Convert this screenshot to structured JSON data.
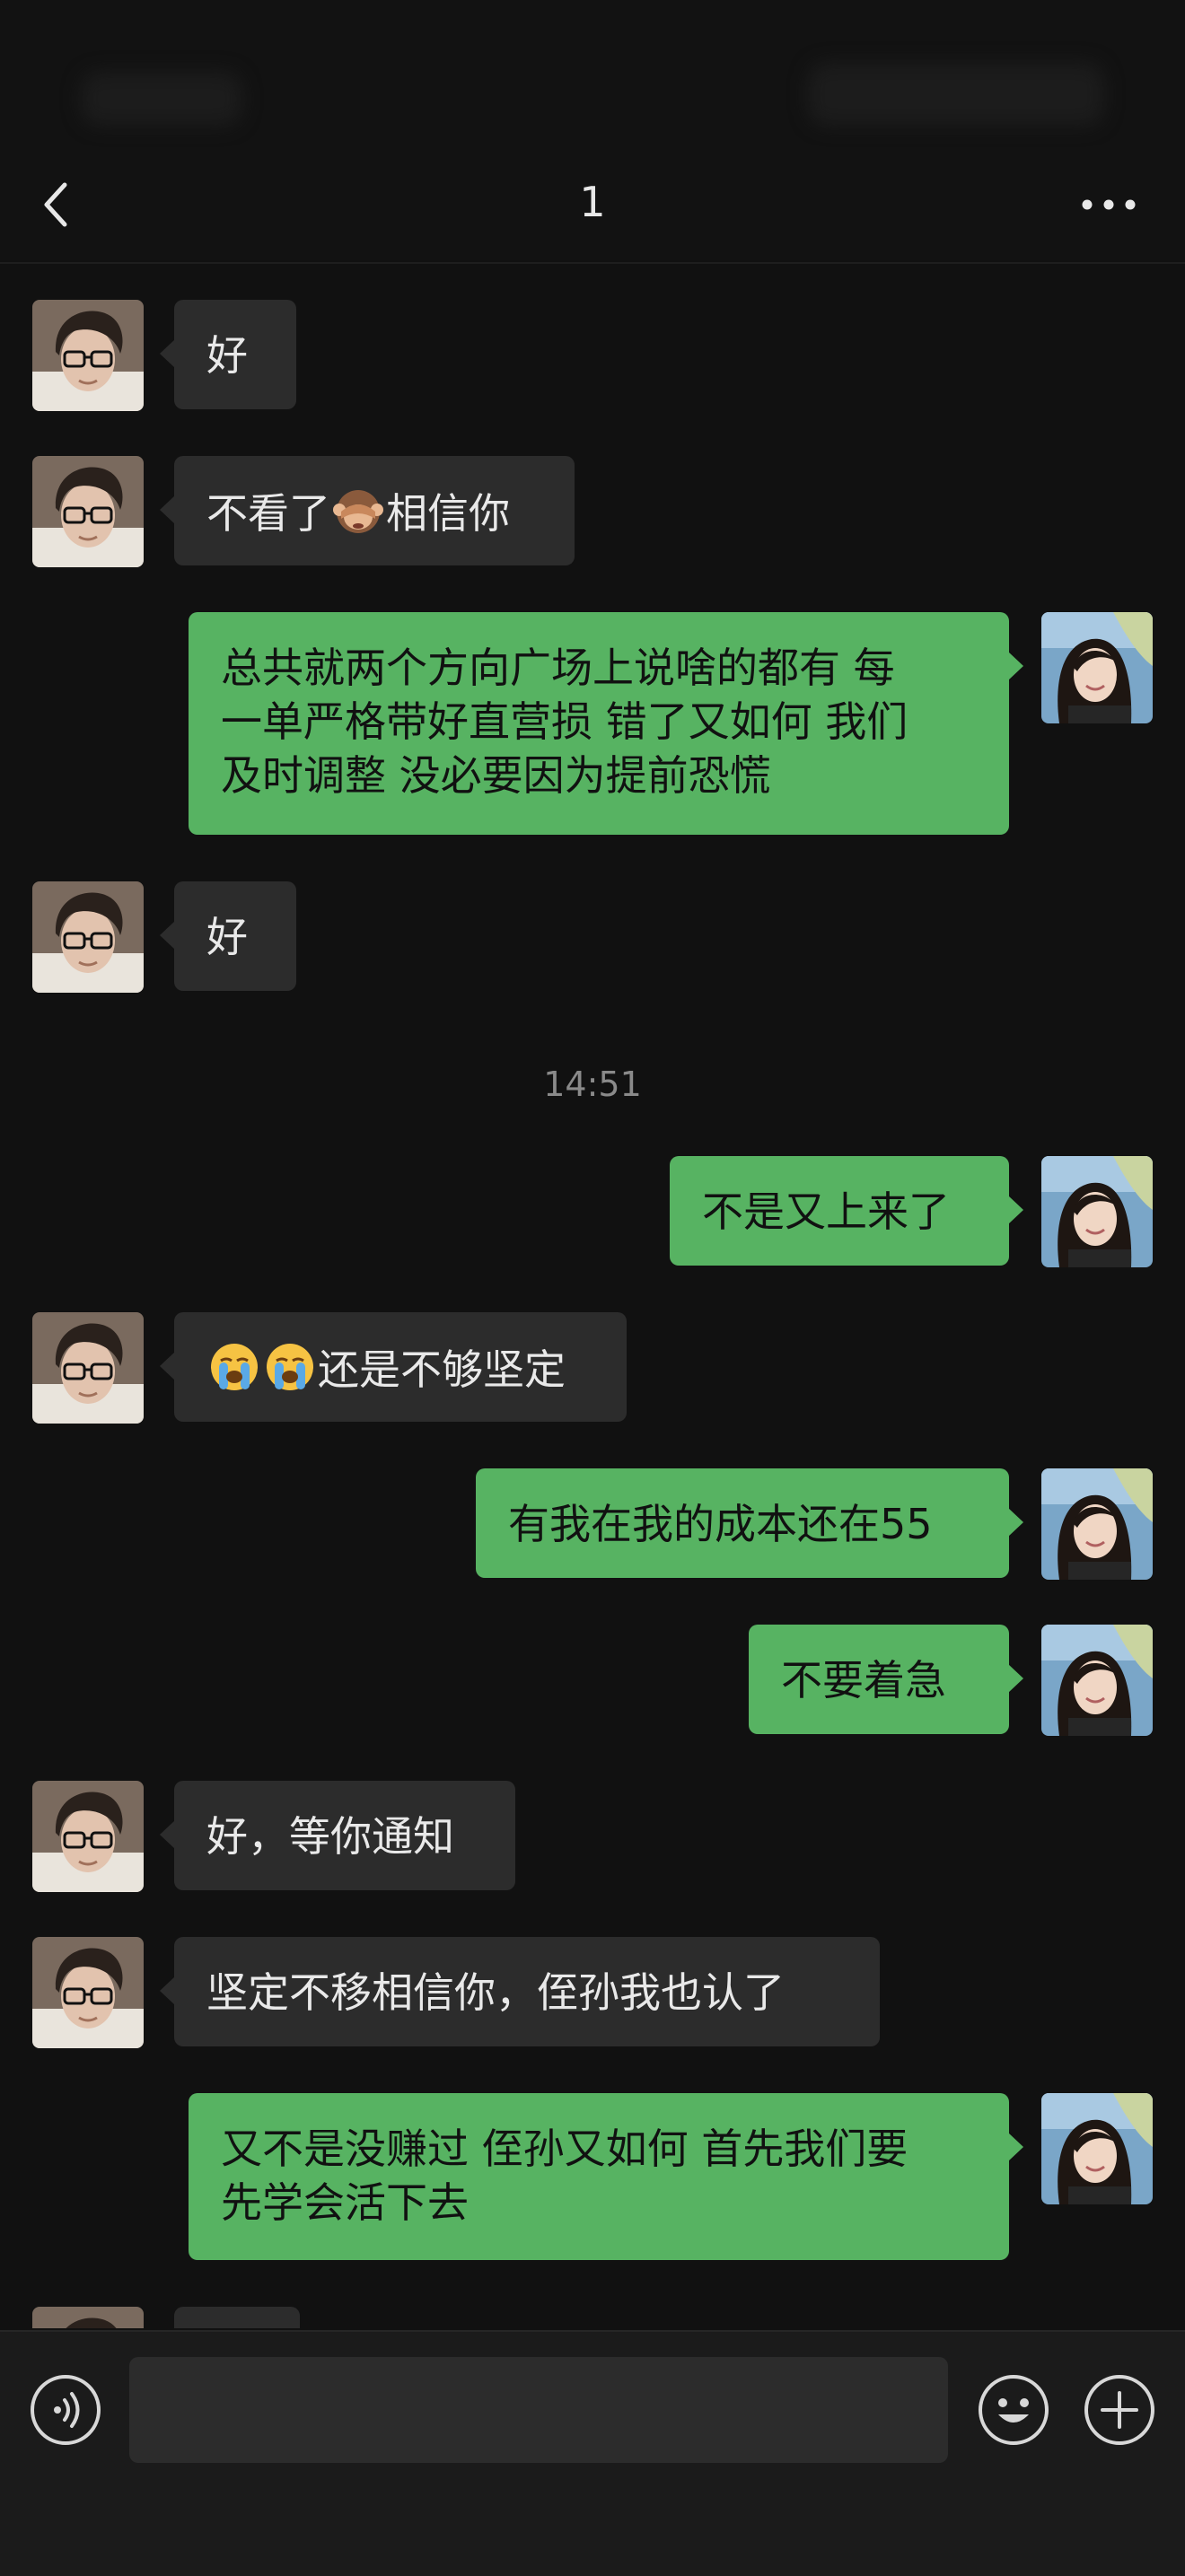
{
  "header": {
    "title": "1"
  },
  "icons": {
    "back": "chevron-left-icon",
    "more": "more-horizontal-icon",
    "voice": "voice-icon",
    "emoji": "emoji-icon",
    "add": "plus-circle-icon"
  },
  "colors": {
    "background": "#111111",
    "incoming_bubble": "#2c2c2c",
    "outgoing_bubble": "#57b362",
    "timestamp_text": "#8a8a8a"
  },
  "messages": [
    {
      "side": "in",
      "text": "好"
    },
    {
      "side": "in",
      "text_before": "不看了",
      "emoji": "see-no-evil-monkey-emoji",
      "text_after": "相信你"
    },
    {
      "side": "out",
      "text": "总共就两个方向广场上说啥的都有 每\n一单严格带好直营损 错了又如何 我们\n及时调整 没必要因为提前恐慌"
    },
    {
      "side": "in",
      "text": "好"
    },
    {
      "side": "time",
      "text": "14:51"
    },
    {
      "side": "out",
      "text": "不是又上来了"
    },
    {
      "side": "in",
      "emoji": "loudly-crying-face-emoji x2",
      "text_after": "还是不够坚定"
    },
    {
      "side": "out",
      "text": "有我在我的成本还在55"
    },
    {
      "side": "out",
      "text": "不要着急"
    },
    {
      "side": "in",
      "text": "好，等你通知"
    },
    {
      "side": "in",
      "text": "坚定不移相信你，侄孙我也认了"
    },
    {
      "side": "out",
      "text": "又不是没赚过 侄孙又如何 首先我们要\n先学会活下去"
    }
  ],
  "input": {
    "value": "",
    "placeholder": ""
  }
}
